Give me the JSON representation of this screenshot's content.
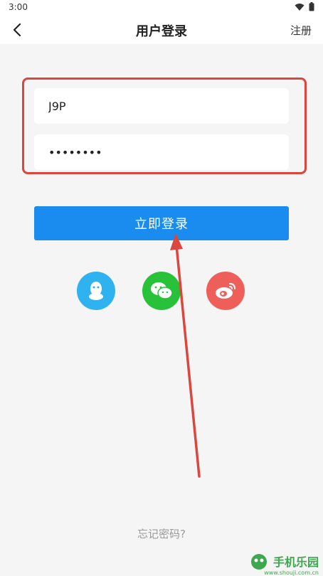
{
  "status_bar": {
    "time": "3:00"
  },
  "app_bar": {
    "title": "用户登录",
    "register_label": "注册"
  },
  "form": {
    "username_value": "J9P",
    "password_value": "••••••••",
    "login_label": "立即登录"
  },
  "social": [
    {
      "name": "qq-icon"
    },
    {
      "name": "wechat-icon"
    },
    {
      "name": "weibo-icon"
    }
  ],
  "footer": {
    "forgot_label": "忘记密码?"
  },
  "watermark": {
    "text": "手机乐园",
    "sub": "www.shouji.com.cn"
  },
  "colors": {
    "primary": "#1a8cf0",
    "highlight": "#d9473e",
    "qq": "#2eb2f0",
    "wechat": "#27c23a",
    "weibo": "#ef5f5a"
  }
}
